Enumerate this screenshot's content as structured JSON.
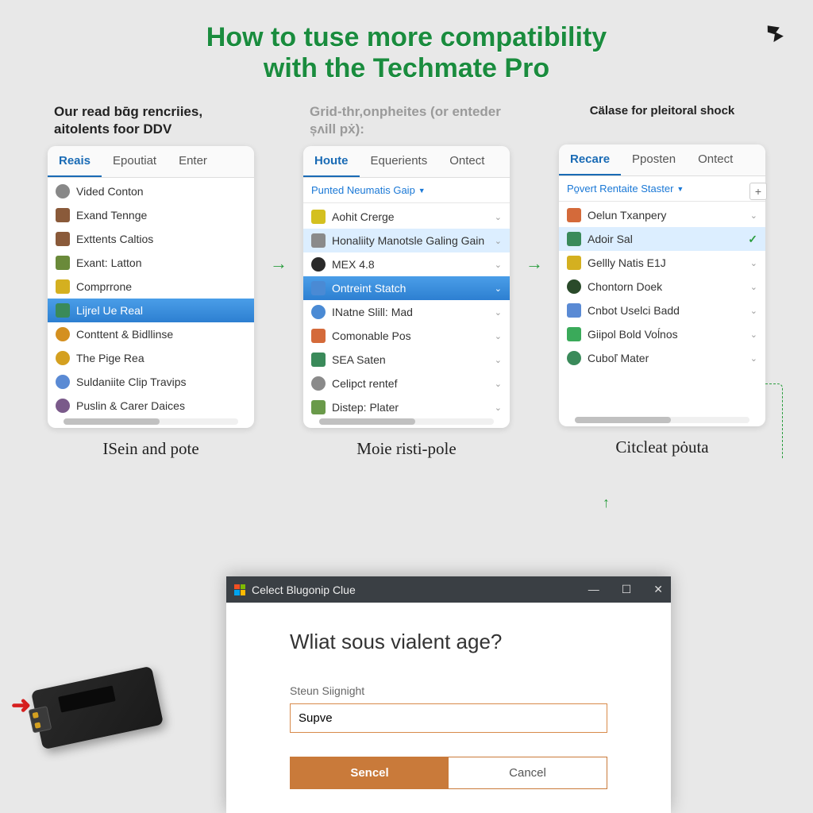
{
  "title_line1": "How to tuse more compatibility",
  "title_line2": "with the Techmate Pro",
  "panels": [
    {
      "heading": "Our read bɑ̄g rencriies, aitolents foor DDV",
      "tabs": [
        "Reais",
        "Epoutiat",
        "Enter"
      ],
      "active_tab": 0,
      "items": [
        {
          "label": "Vided Conton",
          "icon": "globe",
          "color": "#888"
        },
        {
          "label": "Exand Tennge",
          "icon": "square",
          "color": "#8a5a3a"
        },
        {
          "label": "Exttents Caltios",
          "icon": "square",
          "color": "#8a5a3a"
        },
        {
          "label": "Exant: Latton",
          "icon": "square",
          "color": "#6a8a3a"
        },
        {
          "label": "Comprrone",
          "icon": "square",
          "color": "#d4b020"
        },
        {
          "label": "Lijrel Ue Real",
          "icon": "square",
          "color": "#3a8a5a",
          "selected": true
        },
        {
          "label": "Conttent & Bidllinse",
          "icon": "star",
          "color": "#d49020"
        },
        {
          "label": "The Pige Rea",
          "icon": "globe",
          "color": "#d4a020"
        },
        {
          "label": "Suldaniite Clip Travips",
          "icon": "globe",
          "color": "#5a8ad4"
        },
        {
          "label": "Puslin & Carer Daices",
          "icon": "globe",
          "color": "#7a5a8a"
        }
      ],
      "caption": "ISein and pote"
    },
    {
      "heading": "Grid-thr,onpheites (or enteder șʌill pẋ):",
      "heading_gray": true,
      "tabs": [
        "Houte",
        "Equerients",
        "Ontect"
      ],
      "active_tab": 0,
      "dropdown": "Punted Neumatis Gaip",
      "items": [
        {
          "label": "Aohit Crerge",
          "icon": "square",
          "color": "#d4c020",
          "chev": true
        },
        {
          "label": "Honaliity Manotsle Galing Gain",
          "icon": "square",
          "color": "#8a8a8a",
          "chev": true,
          "light": true
        },
        {
          "label": "MEX 4.8",
          "icon": "globe",
          "color": "#2a2a2a",
          "chev": true
        },
        {
          "label": "Ontreint Statch",
          "icon": "square",
          "color": "#4a8ad4",
          "selected": true,
          "chev_white": true
        },
        {
          "label": "INatne Slill: Mad",
          "icon": "globe",
          "color": "#4a8ad4",
          "chev": true
        },
        {
          "label": "Comonable Pos",
          "icon": "square",
          "color": "#d46a3a",
          "chev": true
        },
        {
          "label": "SEA Saten",
          "icon": "square",
          "color": "#3a8a5a",
          "chev": true
        },
        {
          "label": "Celipct rentef",
          "icon": "globe",
          "color": "#8a8a8a",
          "chev": true
        },
        {
          "label": "Distep: Plater",
          "icon": "square",
          "color": "#6a9a4a",
          "chev": true
        }
      ],
      "caption": "Moie risti-pole"
    },
    {
      "heading": "Cälase for pleitoral shock",
      "heading_small": true,
      "tabs": [
        "Recare",
        "Pposten",
        "Ontect"
      ],
      "active_tab": 0,
      "dropdown": "Po̱vert Rentaite Staster",
      "plus": true,
      "items": [
        {
          "label": "Oelun Txanpery",
          "icon": "square",
          "color": "#d46a3a",
          "chev": true
        },
        {
          "label": "Adoir Sal",
          "icon": "square",
          "color": "#3a8a5a",
          "check": true,
          "light": true
        },
        {
          "label": "Gellly Natis E1J",
          "icon": "square",
          "color": "#d4b020",
          "chev": true
        },
        {
          "label": "Chontorn Doek",
          "icon": "globe",
          "color": "#2a4a2a",
          "chev": true
        },
        {
          "label": "Cnbot Uselci Badd",
          "icon": "square",
          "color": "#5a8ad4",
          "chev": true
        },
        {
          "label": "Giipol Bold Voĺnos",
          "icon": "square",
          "color": "#3aaa5a",
          "chev": true
        },
        {
          "label": "Cuboľ Mater",
          "icon": "globe",
          "color": "#3a8a5a",
          "chev": true
        }
      ],
      "caption": "Citcleat pȯuta"
    }
  ],
  "arrow_between": "→",
  "dialog": {
    "title": "Celect Blugonip Clue",
    "question": "Wliat sous vialent age?",
    "field_label": "Steun Siignight",
    "input_value": "Supve ",
    "btn_primary": "Sencel",
    "btn_secondary": "Cancel",
    "win_min": "—",
    "win_max": "☐",
    "win_close": "✕"
  }
}
